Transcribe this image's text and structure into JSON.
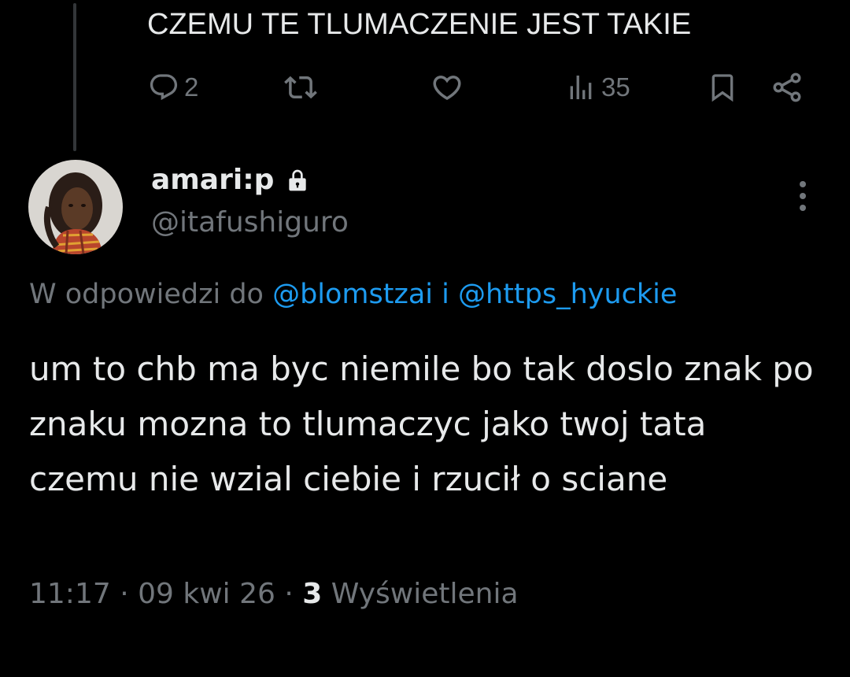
{
  "parent_tweet": {
    "text": "CZEMU TE TLUMACZENIE JEST TAKIE",
    "actions": {
      "reply_icon": "reply-icon",
      "reply_count": "2",
      "retweet_icon": "retweet-icon",
      "like_icon": "heart-icon",
      "views_icon": "views-chart-icon",
      "views_count": "35",
      "bookmark_icon": "bookmark-icon",
      "share_icon": "share-icon"
    }
  },
  "tweet": {
    "author": {
      "display_name": "amari:p",
      "protected_icon": "lock-icon",
      "handle": "@itafushiguro"
    },
    "more_icon": "more-vertical-icon",
    "reply_to": {
      "prefix": "W odpowiedzi do ",
      "mention_1": "@blomstzai",
      "joiner": " i ",
      "mention_2": "@https_hyuckie"
    },
    "text": "um to chb ma byc niemile bo tak doslo znak po znaku mozna to tlumaczyc jako twoj tata czemu nie wzial ciebie i rzucił o sciane",
    "meta": {
      "time": "11:17",
      "separator_1": " · ",
      "date": "09 kwi 26",
      "separator_2": " · ",
      "views_count": "3",
      "views_label": " Wyświetlenia"
    }
  },
  "colors": {
    "background": "#000000",
    "text_primary": "#e7e9ea",
    "text_secondary": "#71767b",
    "accent_link": "#1d9bf0",
    "thread_line": "#333639"
  }
}
